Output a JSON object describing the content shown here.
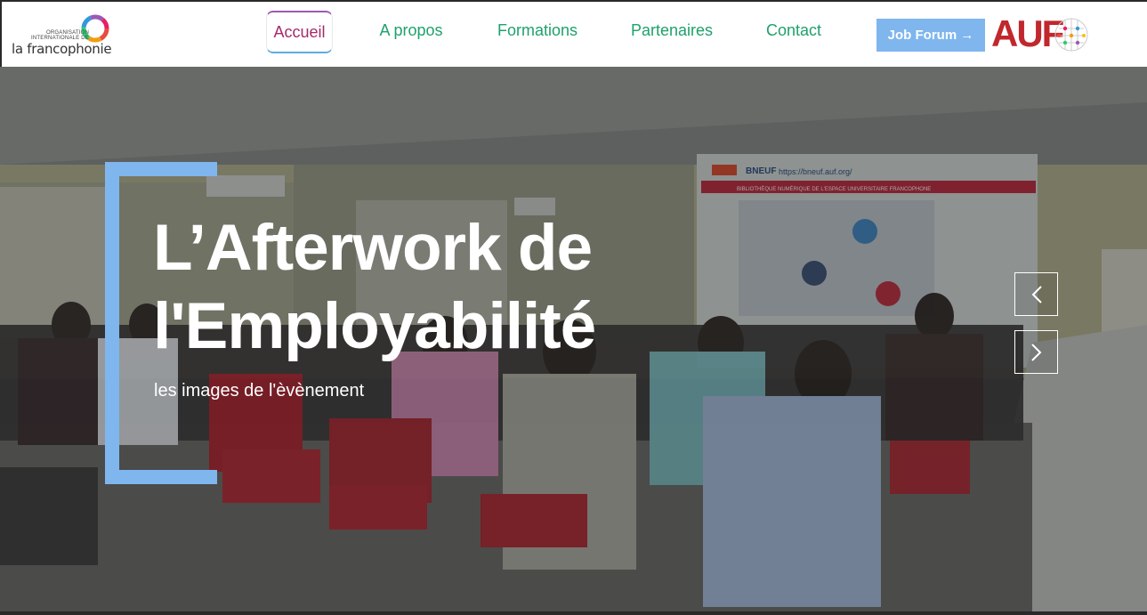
{
  "header": {
    "logo_oif": {
      "small_text": "ORGANISATION INTERNATIONALE DE",
      "big_text": "la francophonie"
    },
    "nav": [
      {
        "label": "Accueil",
        "active": true
      },
      {
        "label": "A propos",
        "active": false
      },
      {
        "label": "Formations",
        "active": false
      },
      {
        "label": "Partenaires",
        "active": false
      },
      {
        "label": "Contact",
        "active": false
      }
    ],
    "job_forum_label": "Job Forum →",
    "auf_logo_text": "AUF"
  },
  "hero": {
    "title_line1": "L’Afterwork de",
    "title_line2": "l'Employabilité",
    "subtitle": "les images de l'èvènement",
    "background_scene": "conference room with seated audience",
    "banner_text": "BNEUF",
    "banner_url": "https://bneuf.auf.org/",
    "banner_subtitle": "BIBLIOTHÈQUE NUMÉRIQUE DE L'ESPACE UNIVERSITAIRE FRANCOPHONE"
  },
  "carousel": {
    "prev_icon": "chevron-left-icon",
    "next_icon": "chevron-right-icon"
  },
  "colors": {
    "nav_green": "#1fa16b",
    "active_red": "#a52a6c",
    "accent_blue": "#7fb6ee",
    "auf_red": "#c1272d"
  }
}
